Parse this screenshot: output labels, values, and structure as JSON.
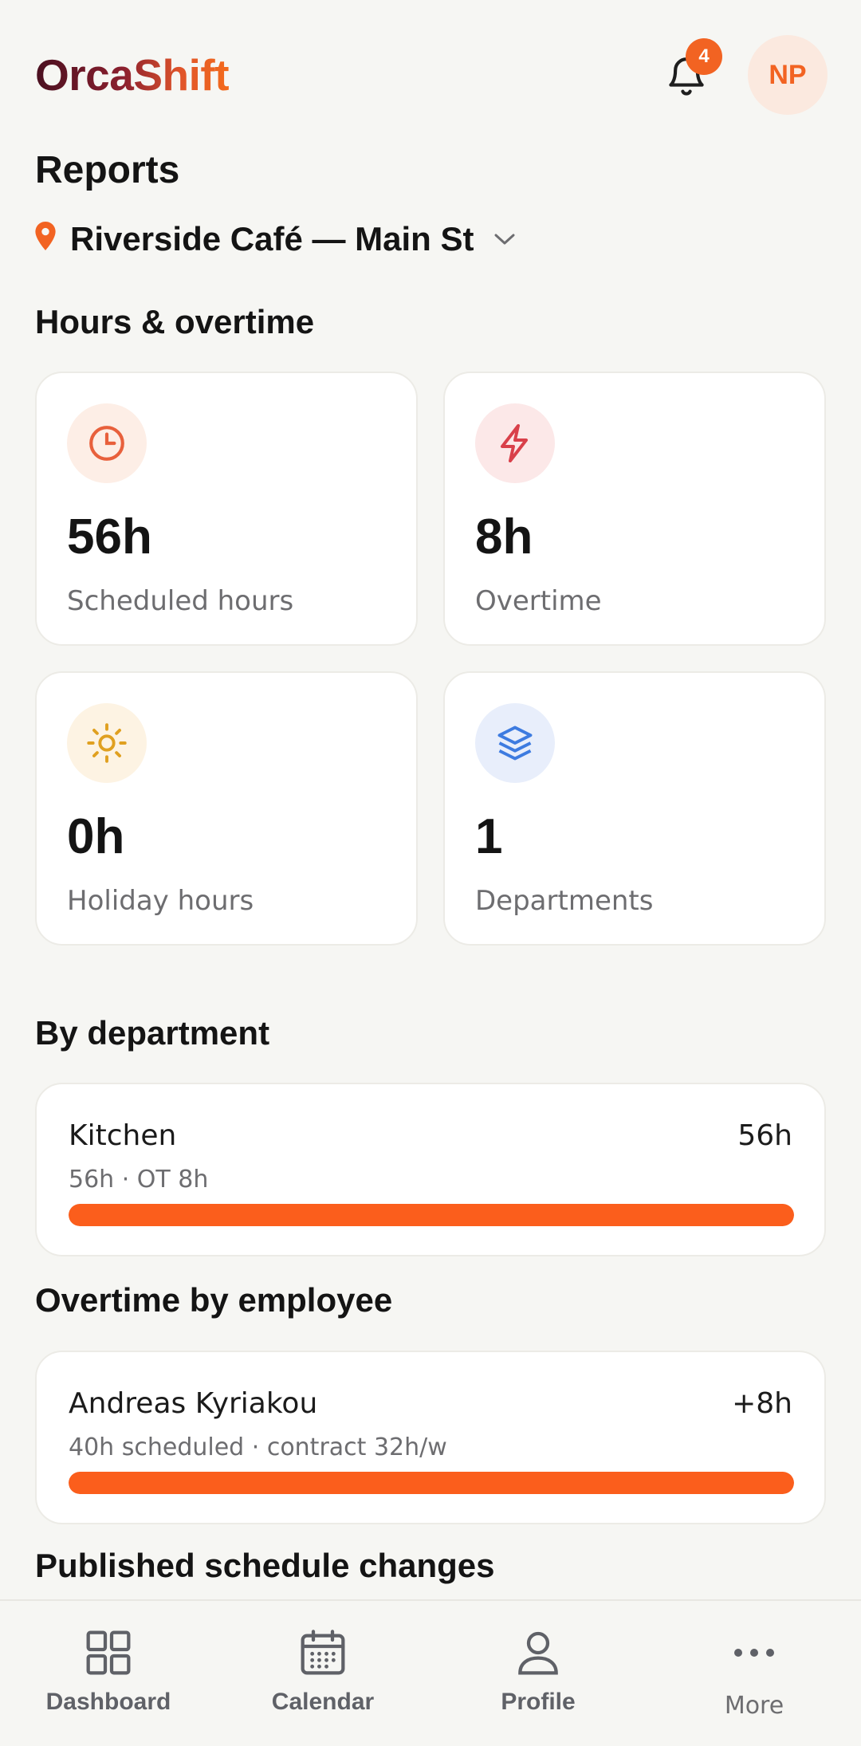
{
  "header": {
    "logo": "OrcaShift",
    "notifications_count": "4",
    "avatar_initials": "NP"
  },
  "page": {
    "title": "Reports",
    "location": "Riverside Café — Main St"
  },
  "hours_section": {
    "title": "Hours & overtime",
    "cards": [
      {
        "value": "56h",
        "label": "Scheduled hours",
        "icon": "clock-icon",
        "color": "#e8603c",
        "bg": "#fdeee6"
      },
      {
        "value": "8h",
        "label": "Overtime",
        "icon": "lightning-icon",
        "color": "#d9404a",
        "bg": "#fce8e8"
      },
      {
        "value": "0h",
        "label": "Holiday hours",
        "icon": "sun-icon",
        "color": "#e0a020",
        "bg": "#fdf3e3"
      },
      {
        "value": "1",
        "label": "Departments",
        "icon": "layers-icon",
        "color": "#3d7be0",
        "bg": "#e8eefb"
      }
    ]
  },
  "department_section": {
    "title": "By department",
    "rows": [
      {
        "name": "Kitchen",
        "value": "56h",
        "sub": "56h · OT 8h",
        "fill": 1.0
      }
    ]
  },
  "overtime_section": {
    "title": "Overtime by employee",
    "rows": [
      {
        "name": "Andreas Kyriakou",
        "value": "+8h",
        "sub": "40h scheduled · contract 32h/w",
        "fill": 1.0
      }
    ]
  },
  "changes_section": {
    "title": "Published schedule changes"
  },
  "nav": {
    "dashboard": "Dashboard",
    "calendar": "Calendar",
    "profile": "Profile",
    "more": "More"
  },
  "colors": {
    "accent": "#f26322",
    "bar": "#fb5e1c"
  }
}
